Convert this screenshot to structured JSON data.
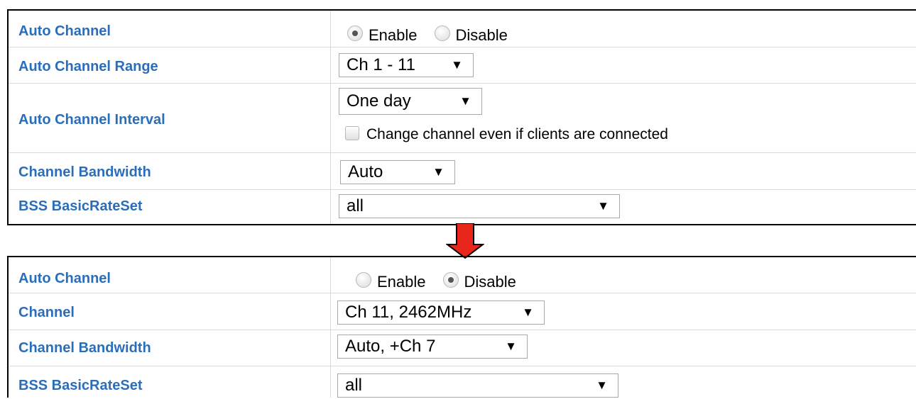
{
  "top_panel": {
    "auto_channel": {
      "label": "Auto Channel",
      "enable": "Enable",
      "disable": "Disable",
      "selected": "Enable"
    },
    "auto_channel_range": {
      "label": "Auto Channel Range",
      "value": "Ch 1 - 11"
    },
    "auto_channel_interval": {
      "label": "Auto Channel Interval",
      "value": "One day",
      "checkbox_label": "Change channel even if clients are connected"
    },
    "channel_bandwidth": {
      "label": "Channel Bandwidth",
      "value": "Auto"
    },
    "bss_basic_rate_set": {
      "label": "BSS BasicRateSet",
      "value": "all"
    }
  },
  "bottom_panel": {
    "auto_channel": {
      "label": "Auto Channel",
      "enable": "Enable",
      "disable": "Disable",
      "selected": "Disable"
    },
    "channel": {
      "label": "Channel",
      "value": "Ch 11, 2462MHz"
    },
    "channel_bandwidth": {
      "label": "Channel Bandwidth",
      "value": "Auto, +Ch 7"
    },
    "bss_basic_rate_set": {
      "label": "BSS BasicRateSet",
      "value": "all"
    }
  },
  "icons": {
    "arrow": "down-arrow-icon",
    "select_arrow": "▼"
  },
  "colors": {
    "label": "#2a6ebb",
    "arrow_fill": "#e8261c"
  }
}
